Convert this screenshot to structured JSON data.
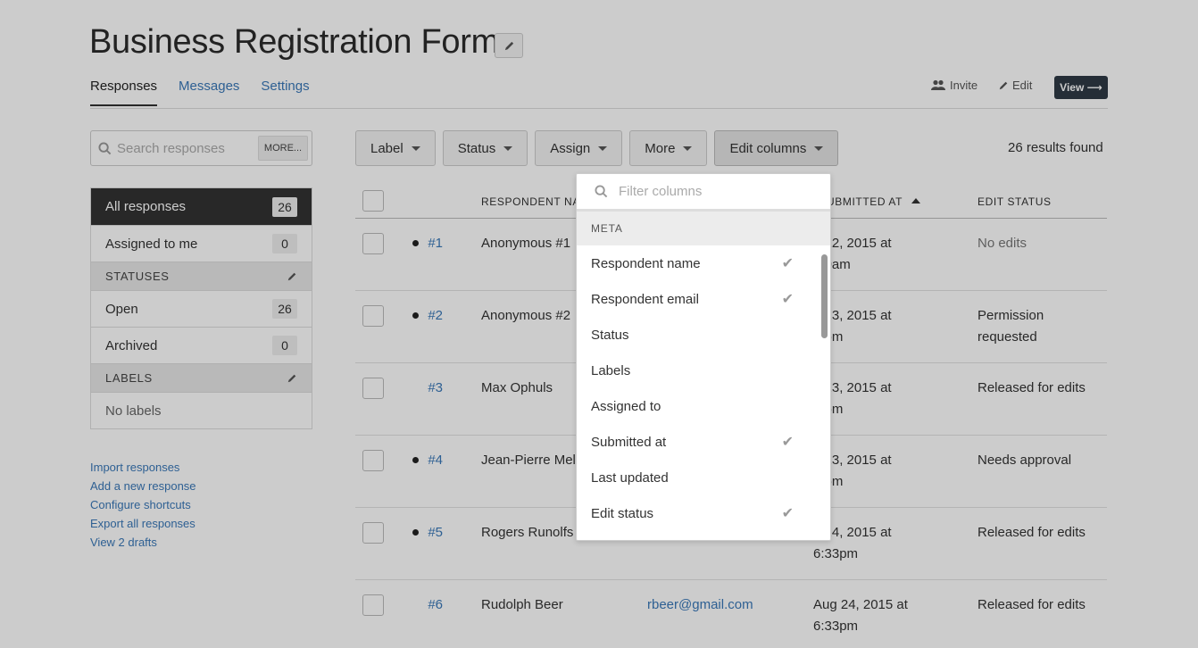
{
  "page": {
    "title": "Business Registration Form",
    "tabs": [
      {
        "label": "Responses",
        "active": true
      },
      {
        "label": "Messages",
        "active": false
      },
      {
        "label": "Settings",
        "active": false
      }
    ],
    "actions": {
      "invite": "Invite",
      "edit": "Edit",
      "view": "View ⟶"
    }
  },
  "search": {
    "placeholder": "Search responses",
    "more_label": "MORE..."
  },
  "sidebar": {
    "all": {
      "label": "All responses",
      "count": "26"
    },
    "assigned": {
      "label": "Assigned to me",
      "count": "0"
    },
    "statuses_header": "STATUSES",
    "statuses": [
      {
        "label": "Open",
        "count": "26"
      },
      {
        "label": "Archived",
        "count": "0"
      }
    ],
    "labels_header": "LABELS",
    "labels_empty": "No labels"
  },
  "links": [
    "Import responses",
    "Add a new response",
    "Configure shortcuts",
    "Export all responses",
    "View 2 drafts"
  ],
  "toolbar": {
    "label": "Label",
    "status": "Status",
    "assign": "Assign",
    "more": "More",
    "edit_columns": "Edit columns",
    "results": "26 results found"
  },
  "table": {
    "headers": {
      "respondent": "RESPONDENT NA",
      "submitted": "UBMITTED AT",
      "edit_status": "EDIT STATUS"
    },
    "rows": [
      {
        "num": "#1",
        "dot": true,
        "name": "Anonymous #1",
        "email": "",
        "date1": "g 22, 2015 at",
        "date2": ":20am",
        "status1": "No edits",
        "status2": "",
        "muted": true
      },
      {
        "num": "#2",
        "dot": true,
        "name": "Anonymous #2",
        "email": "",
        "date1": "g 23, 2015 at",
        "date2": ":2pm",
        "status1": "Permission",
        "status2": "requested",
        "muted": false
      },
      {
        "num": "#3",
        "dot": false,
        "name": "Max Ophuls",
        "email": "",
        "date1": "g 23, 2015 at",
        "date2": ":4pm",
        "status1": "Released for edits",
        "status2": "",
        "muted": false
      },
      {
        "num": "#4",
        "dot": true,
        "name": "Jean-Pierre Mel",
        "email": "",
        "date1": "g 23, 2015 at",
        "date2": ":0pm",
        "status1": "Needs approval",
        "status2": "",
        "muted": false
      },
      {
        "num": "#5",
        "dot": true,
        "name": "Rogers Runolfs",
        "email": "",
        "date1": "g 24, 2015 at",
        "date2": "6:33pm",
        "status1": "Released for edits",
        "status2": "",
        "muted": false
      },
      {
        "num": "#6",
        "dot": false,
        "name": "Rudolph Beer",
        "email": "rbeer@gmail.com",
        "date1": "Aug 24, 2015 at",
        "date2": "6:33pm",
        "status1": "Released for edits",
        "status2": "",
        "muted": false
      }
    ]
  },
  "dropdown": {
    "filter_placeholder": "Filter columns",
    "section": "META",
    "items": [
      {
        "label": "Respondent name",
        "checked": true
      },
      {
        "label": "Respondent email",
        "checked": true
      },
      {
        "label": "Status",
        "checked": false
      },
      {
        "label": "Labels",
        "checked": false
      },
      {
        "label": "Assigned to",
        "checked": false
      },
      {
        "label": "Submitted at",
        "checked": true
      },
      {
        "label": "Last updated",
        "checked": false
      },
      {
        "label": "Edit status",
        "checked": true
      }
    ],
    "check_glyph": "✔"
  }
}
